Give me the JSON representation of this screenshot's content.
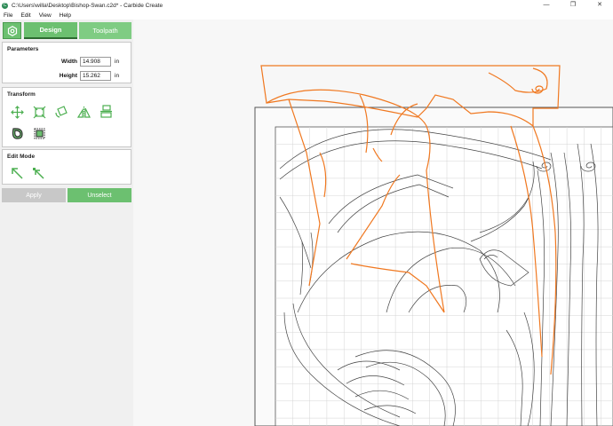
{
  "window": {
    "title": "C:\\Users\\willa\\Desktop\\Bishop-Swan.c2d* - Carbide Create",
    "minimize": "—",
    "maximize": "❐",
    "close": "✕"
  },
  "menu": {
    "file": "File",
    "edit": "Edit",
    "view": "View",
    "help": "Help"
  },
  "tabs": {
    "design": "Design",
    "toolpath": "Toolpath"
  },
  "parameters": {
    "title": "Parameters",
    "width_label": "Width",
    "width_value": "14.908",
    "width_unit": "in",
    "height_label": "Height",
    "height_value": "15.262",
    "height_unit": "in"
  },
  "transform": {
    "title": "Transform",
    "tools": [
      "move-icon",
      "scale-icon",
      "rotate-icon",
      "mirror-icon",
      "align-icon",
      "offset-icon",
      "fit-icon"
    ]
  },
  "edit_mode": {
    "title": "Edit Mode",
    "tools": [
      "select-node-icon",
      "edit-node-icon"
    ]
  },
  "buttons": {
    "apply": "Apply",
    "unselect": "Unselect"
  },
  "colors": {
    "accent_green": "#6cc070",
    "selection_orange": "#f07820",
    "vector_gray": "#555555",
    "grid": "#d0d0d0"
  }
}
